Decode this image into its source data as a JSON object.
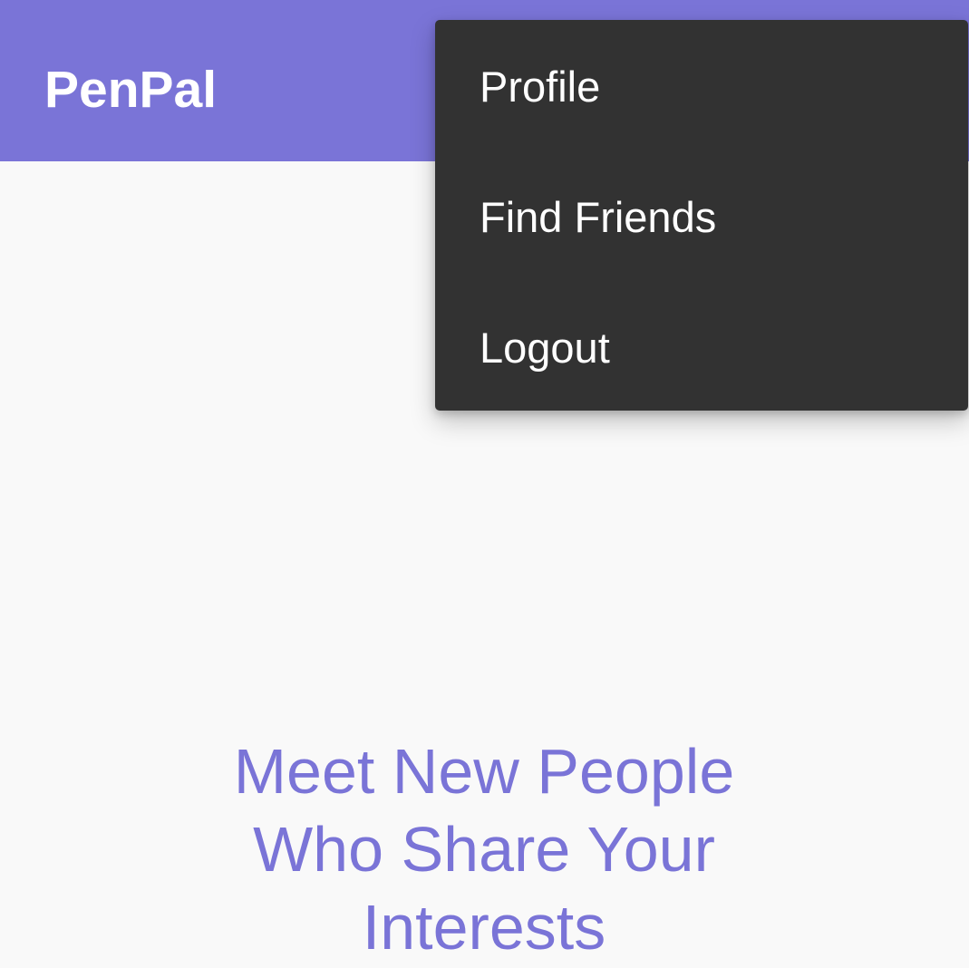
{
  "app_bar": {
    "title": "PenPal"
  },
  "overflow_menu": {
    "items": [
      {
        "label": "Profile"
      },
      {
        "label": "Find Friends"
      },
      {
        "label": "Logout"
      }
    ]
  },
  "main": {
    "tagline_lines": [
      "Meet New People",
      "Who Share Your",
      "Interests"
    ]
  },
  "colors": {
    "accent": "#7a74d7",
    "menu_background": "#323232",
    "page_background": "#f9f9f9"
  }
}
